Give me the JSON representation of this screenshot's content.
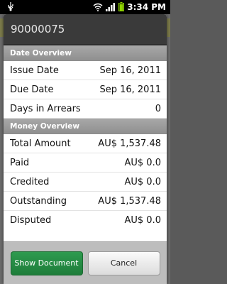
{
  "status_bar": {
    "time": "3:34 PM",
    "icons": [
      "usb-icon",
      "wifi-icon",
      "signal-icon",
      "battery-icon"
    ]
  },
  "dialog": {
    "title": "90000075",
    "sections": {
      "date_overview": {
        "header": "Date Overview",
        "rows": [
          {
            "label": "Issue Date",
            "value": "Sep 16, 2011"
          },
          {
            "label": "Due Date",
            "value": "Sep 16, 2011"
          },
          {
            "label": "Days in Arrears",
            "value": "0"
          }
        ]
      },
      "money_overview": {
        "header": "Money Overview",
        "rows": [
          {
            "label": "Total Amount",
            "value": "AU$ 1,537.48"
          },
          {
            "label": "Paid",
            "value": "AU$ 0.0"
          },
          {
            "label": "Credited",
            "value": "AU$ 0.0"
          },
          {
            "label": "Outstanding",
            "value": "AU$ 1,537.48"
          },
          {
            "label": "Disputed",
            "value": "AU$ 0.0"
          }
        ]
      }
    },
    "buttons": {
      "show_document": "Show Document",
      "cancel": "Cancel"
    }
  },
  "colors": {
    "primary_button": "#1e7d3a",
    "title_bar": "#3a3a3a",
    "section_header": "#9a9a9a"
  }
}
